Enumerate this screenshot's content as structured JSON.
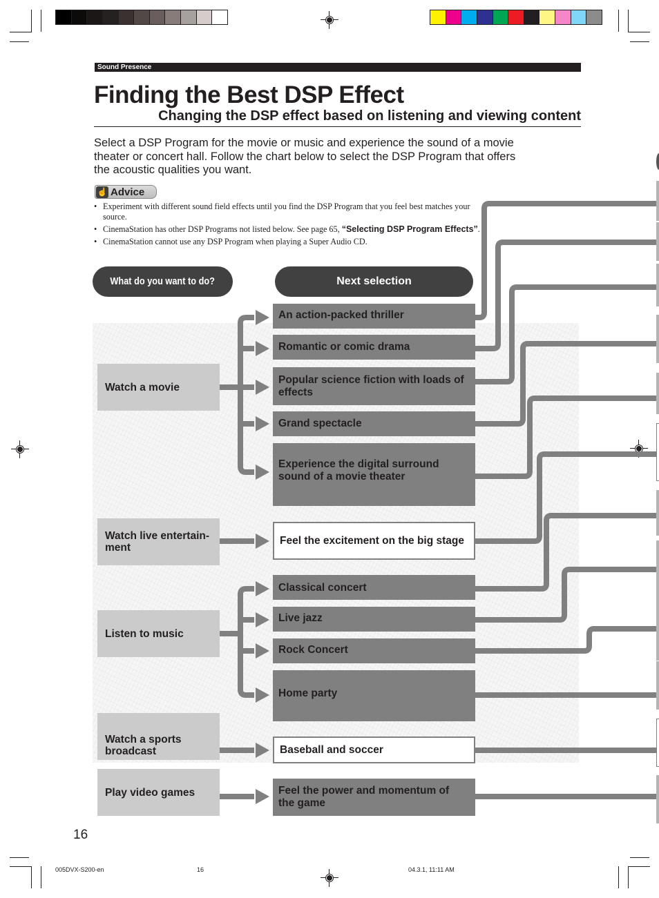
{
  "print_marks": {
    "grayscale_swatches": [
      "#000000",
      "#0d0b0a",
      "#1a1716",
      "#252120",
      "#3a3130",
      "#524846",
      "#6a5e5c",
      "#877c7a",
      "#a8a09e",
      "#d5cdcc",
      "#ffffff"
    ],
    "color_swatches": [
      "#fff200",
      "#ec008c",
      "#00aeef",
      "#2e3192",
      "#00a651",
      "#ed1c24",
      "#231f20",
      "#fff685",
      "#f587c8",
      "#7fd6f7",
      "#8c8c8c"
    ]
  },
  "header": {
    "section": "Sound Presence",
    "title": "Finding the Best DSP Effect",
    "subtitle": "Changing the DSP effect based on listening and viewing content"
  },
  "intro": "Select a DSP Program for the movie or music and experience the sound of a movie theater or concert hall. Follow the chart below to select the DSP Program that offers the acoustic qualities you want.",
  "advice": {
    "label": "Advice",
    "icon": "pointing-hand-icon",
    "items": [
      {
        "text": "Experiment with different sound field effects until you find the DSP Program that you feel best matches your source."
      },
      {
        "text": "CinemaStation has other DSP Programs not listed below. See page 65, ",
        "ref": "“Selecting DSP Program Effects”",
        "tail": "."
      },
      {
        "text": "CinemaStation cannot use any DSP Program when playing a Super Audio CD."
      }
    ]
  },
  "flowchart": {
    "left_header": "What do you want to do?",
    "right_header": "Next selection",
    "categories": [
      {
        "label": "Watch a movie"
      },
      {
        "label": "Watch live entertain-ment"
      },
      {
        "label": "Listen to music"
      },
      {
        "label": "Watch a sports broadcast"
      },
      {
        "label": "Play video games"
      }
    ],
    "options": [
      {
        "label": "An action-packed thriller",
        "category": "Watch a movie",
        "style": "gray"
      },
      {
        "label": "Romantic or comic drama",
        "category": "Watch a movie",
        "style": "gray"
      },
      {
        "label": "Popular science fiction with loads of effects",
        "category": "Watch a movie",
        "style": "gray"
      },
      {
        "label": "Grand spectacle",
        "category": "Watch a movie",
        "style": "gray"
      },
      {
        "label": "Experience the digital surround sound of a movie theater",
        "category": "Watch a movie",
        "style": "gray"
      },
      {
        "label": "Feel the excitement on the big stage",
        "category": "Watch live entertain-ment",
        "style": "white"
      },
      {
        "label": "Classical concert",
        "category": "Listen to music",
        "style": "gray"
      },
      {
        "label": "Live jazz",
        "category": "Listen to music",
        "style": "gray"
      },
      {
        "label": "Rock Concert",
        "category": "Listen to music",
        "style": "gray"
      },
      {
        "label": "Home party",
        "category": "Listen to music",
        "style": "gray"
      },
      {
        "label": "Baseball and soccer",
        "category": "Watch a sports broadcast",
        "style": "white"
      },
      {
        "label": "Feel the power and momentum of the game",
        "category": "Play video games",
        "style": "gray"
      }
    ]
  },
  "footer": {
    "page_number": "16",
    "file": "005DVX-S200-en",
    "sheet": "16",
    "timestamp": "04.3.1, 11:11 AM"
  }
}
